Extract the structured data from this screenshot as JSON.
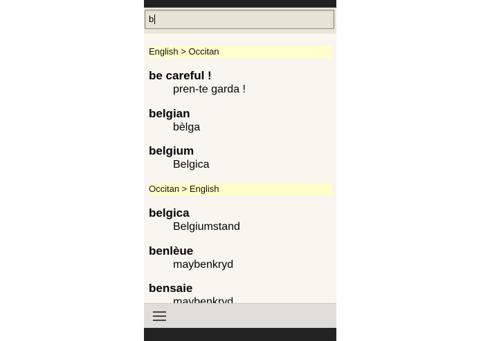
{
  "search": {
    "value": "b"
  },
  "sections": [
    {
      "header": "English > Occitan",
      "entries": [
        {
          "term": "be careful !",
          "definition": "pren-te garda !"
        },
        {
          "term": "belgian",
          "definition": "bèlga"
        },
        {
          "term": "belgium",
          "definition": "Belgica"
        }
      ]
    },
    {
      "header": "Occitan > English",
      "entries": [
        {
          "term": "belgica",
          "definition": "Belgiumstand"
        },
        {
          "term": "benlèue",
          "definition": "maybenkryd"
        },
        {
          "term": "bensaie",
          "definition": "maybenkryd"
        }
      ]
    }
  ],
  "icons": {
    "menu": "menu-icon"
  }
}
